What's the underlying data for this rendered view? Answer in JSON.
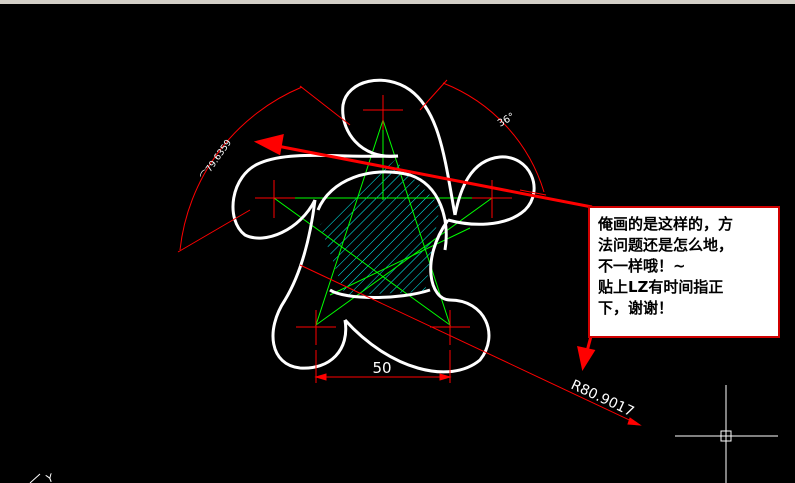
{
  "drawing": {
    "dim_horizontal": "50",
    "dim_radius": "R80.9017",
    "dim_angle": "36°",
    "dim_arc": "⌒79.6359",
    "axis_label": "Y"
  },
  "callout": {
    "lines": [
      "俺画的是这样的，方",
      "法问题还是怎么地，",
      "不一样哦！~",
      "贴上LZ有时间指正",
      "下，谢谢！"
    ]
  },
  "colors": {
    "background": "#000000",
    "geometry": "#ffffff",
    "construction": "#00ff00",
    "dimension": "#ff0000",
    "hatch": "#00ffff",
    "annotation_arrow": "#ff0000",
    "callout_border": "#d00000"
  }
}
